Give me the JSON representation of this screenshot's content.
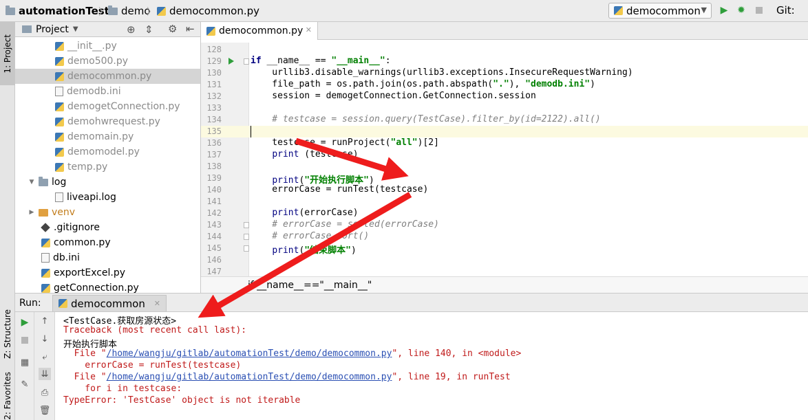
{
  "breadcrumb": {
    "project": "automationTest",
    "folder": "demo",
    "file": "democommon.py"
  },
  "toolbar": {
    "run_config": "democommon",
    "vcs_label": "Git:"
  },
  "left_strip": {
    "project_tab": "1: Project",
    "structure_tab": "Z: Structure",
    "favorites_tab": "2: Favorites"
  },
  "project_panel": {
    "title": "Project",
    "items": [
      {
        "name": "__init__.py",
        "muted": true
      },
      {
        "name": "demo500.py",
        "muted": true
      },
      {
        "name": "democommon.py",
        "muted": true,
        "selected": true
      },
      {
        "name": "demodb.ini",
        "muted": true
      },
      {
        "name": "demogetConnection.py",
        "muted": true
      },
      {
        "name": "demohwrequest.py",
        "muted": true
      },
      {
        "name": "demomain.py",
        "muted": true
      },
      {
        "name": "demomodel.py",
        "muted": true
      },
      {
        "name": "temp.py",
        "muted": true
      },
      {
        "name": "log",
        "muted": false
      },
      {
        "name": "liveapi.log",
        "muted": false
      },
      {
        "name": "venv",
        "muted": false
      },
      {
        "name": ".gitignore",
        "muted": false
      },
      {
        "name": "common.py",
        "muted": false
      },
      {
        "name": "db.ini",
        "muted": false
      },
      {
        "name": "exportExcel.py",
        "muted": false
      },
      {
        "name": "getConnection.py",
        "muted": false
      }
    ]
  },
  "editor": {
    "tab_label": "democommon.py",
    "status_path": "if __name__==\"__main__\"",
    "line_numbers": [
      "128",
      "129",
      "130",
      "131",
      "132",
      "133",
      "134",
      "135",
      "136",
      "137",
      "138",
      "139",
      "140",
      "141",
      "142",
      "143",
      "144",
      "145",
      "146",
      "147"
    ]
  },
  "run_panel": {
    "label": "Run:",
    "tab_label": "democommon",
    "console": [
      {
        "text": "<TestCase.获取房源状态>",
        "kind": "normal"
      },
      {
        "text": "Traceback (most recent call last):",
        "kind": "err"
      },
      {
        "text": "开始执行脚本",
        "kind": "normal"
      },
      {
        "text": "  File \"",
        "kind": "err"
      },
      {
        "text": "    errorCase = runTest(testcase)",
        "kind": "err"
      },
      {
        "text": "  File \"",
        "kind": "err"
      },
      {
        "text": "    for i in testcase:",
        "kind": "err"
      },
      {
        "text": "TypeError: 'TestCase' object is not iterable",
        "kind": "err"
      }
    ],
    "file_path": "/home/wangju/gitlab/automationTest/demo/democommon.py",
    "frame1_tail": "\", line 140, in <module>",
    "frame2_tail": "\", line 19, in runTest"
  },
  "colors": {
    "arrow": "#ee1c1c",
    "error_text": "#c01a1a",
    "run_green": "#2f9e3b"
  }
}
